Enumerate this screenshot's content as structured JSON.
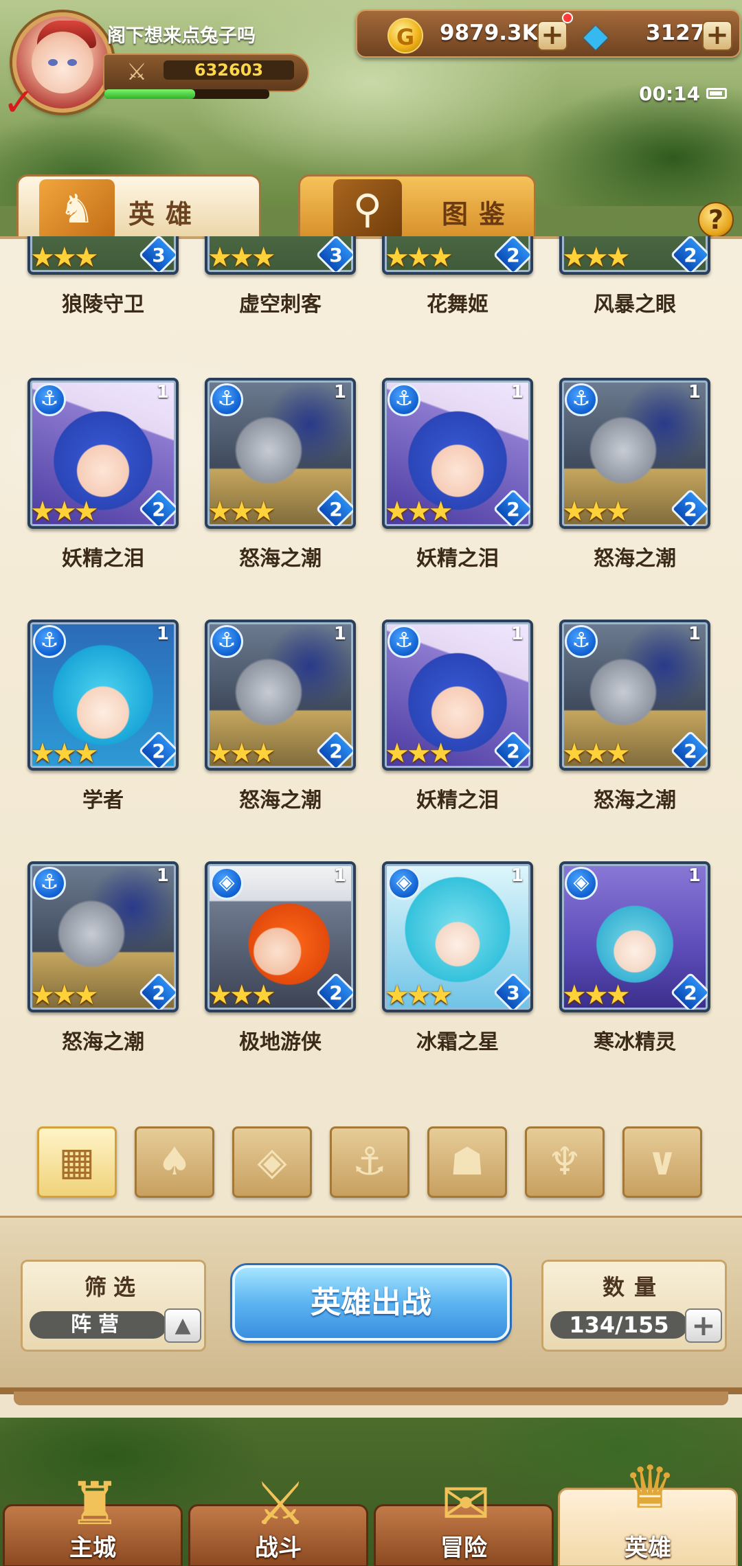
{
  "player": {
    "name": "阁下想来点兔子吗",
    "power": "632603",
    "exp_percent": 0.55
  },
  "currency": {
    "gold": "9879.3K",
    "gems": "3127"
  },
  "clock": "00:14",
  "tabs": {
    "heroes": "英雄",
    "codex": "图鉴",
    "help": "?"
  },
  "partial_row": [
    {
      "name": "狼陵守卫",
      "level": "",
      "stars": "★★★",
      "grade": "3",
      "badge": ""
    },
    {
      "name": "虚空刺客",
      "level": "",
      "stars": "★★★",
      "grade": "3",
      "badge": ""
    },
    {
      "name": "花舞姬",
      "level": "",
      "stars": "★★★",
      "grade": "2",
      "badge": ""
    },
    {
      "name": "风暴之眼",
      "level": "",
      "stars": "★★★",
      "grade": "2",
      "badge": ""
    }
  ],
  "heroes": [
    {
      "name": "妖精之泪",
      "level": "1",
      "stars": "★★★",
      "grade": "2",
      "badge": "⚓",
      "portrait": "fairy"
    },
    {
      "name": "怒海之潮",
      "level": "1",
      "stars": "★★★",
      "grade": "2",
      "badge": "⚓",
      "portrait": "knight"
    },
    {
      "name": "妖精之泪",
      "level": "1",
      "stars": "★★★",
      "grade": "2",
      "badge": "⚓",
      "portrait": "fairy"
    },
    {
      "name": "怒海之潮",
      "level": "1",
      "stars": "★★★",
      "grade": "2",
      "badge": "⚓",
      "portrait": "knight"
    },
    {
      "name": "学者",
      "level": "1",
      "stars": "★★★",
      "grade": "2",
      "badge": "⚓",
      "portrait": "scholar"
    },
    {
      "name": "怒海之潮",
      "level": "1",
      "stars": "★★★",
      "grade": "2",
      "badge": "⚓",
      "portrait": "knight"
    },
    {
      "name": "妖精之泪",
      "level": "1",
      "stars": "★★★",
      "grade": "2",
      "badge": "⚓",
      "portrait": "fairy"
    },
    {
      "name": "怒海之潮",
      "level": "1",
      "stars": "★★★",
      "grade": "2",
      "badge": "⚓",
      "portrait": "knight"
    },
    {
      "name": "怒海之潮",
      "level": "1",
      "stars": "★★★",
      "grade": "2",
      "badge": "⚓",
      "portrait": "knight"
    },
    {
      "name": "极地游侠",
      "level": "1",
      "stars": "★★★",
      "grade": "2",
      "badge": "◈",
      "portrait": "ranger"
    },
    {
      "name": "冰霜之星",
      "level": "1",
      "stars": "★★★",
      "grade": "3",
      "badge": "◈",
      "portrait": "star"
    },
    {
      "name": "寒冰精灵",
      "level": "1",
      "stars": "★★★",
      "grade": "2",
      "badge": "◈",
      "portrait": "ice"
    }
  ],
  "factions": [
    {
      "icon": "grid-icon",
      "glyph": "▦",
      "active": true
    },
    {
      "icon": "leaf-icon",
      "glyph": "♠",
      "active": false
    },
    {
      "icon": "diamond-icon",
      "glyph": "◈",
      "active": false
    },
    {
      "icon": "anchor-icon",
      "glyph": "⚓",
      "active": false
    },
    {
      "icon": "beast-icon",
      "glyph": "☗",
      "active": false
    },
    {
      "icon": "demon-icon",
      "glyph": "♆",
      "active": false
    },
    {
      "icon": "wing-icon",
      "glyph": "∨",
      "active": false
    }
  ],
  "filter": {
    "title": "筛选",
    "value": "阵营"
  },
  "deploy_label": "英雄出战",
  "count": {
    "title": "数量",
    "value": "134/155"
  },
  "nav": [
    {
      "label": "主城",
      "icon": "castle-icon",
      "glyph": "♜"
    },
    {
      "label": "战斗",
      "icon": "swords-icon",
      "glyph": "⚔"
    },
    {
      "label": "冒险",
      "icon": "scroll-icon",
      "glyph": "✉"
    },
    {
      "label": "英雄",
      "icon": "helmet-icon",
      "glyph": "♛"
    }
  ]
}
